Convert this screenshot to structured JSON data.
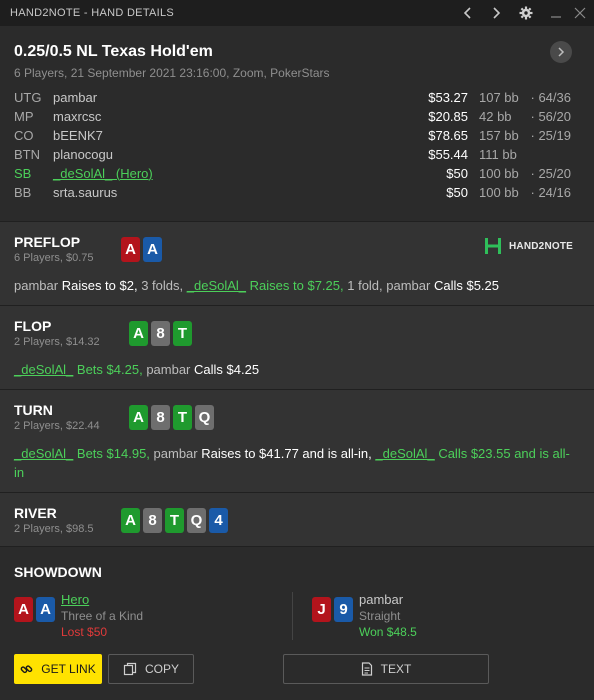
{
  "window": {
    "title": "HAND2NOTE - HAND DETAILS",
    "icons": [
      "chevron-left-icon",
      "chevron-right-icon",
      "gear-icon",
      "minimize-icon",
      "close-icon"
    ]
  },
  "game": {
    "title": "0.25/0.5 NL Texas Hold'em",
    "subtitle": "6 Players, 21 September 2021 23:16:00, Zoom, PokerStars"
  },
  "players": [
    {
      "pos": "UTG",
      "name": "pambar",
      "stack": "$53.27",
      "bb": "107 bb",
      "stat": "64/36",
      "hero": false
    },
    {
      "pos": "MP",
      "name": "maxrcsc",
      "stack": "$20.85",
      "bb": "42 bb",
      "stat": "56/20",
      "hero": false
    },
    {
      "pos": "CO",
      "name": "bEENK7",
      "stack": "$78.65",
      "bb": "157 bb",
      "stat": "25/19",
      "hero": false
    },
    {
      "pos": "BTN",
      "name": "planocogu",
      "stack": "$55.44",
      "bb": "111 bb",
      "stat": "",
      "hero": false
    },
    {
      "pos": "SB",
      "name": "_deSolAl_ (Hero)",
      "stack": "$50",
      "bb": "100 bb",
      "stat": "25/20",
      "hero": true
    },
    {
      "pos": "BB",
      "name": "srta.saurus",
      "stack": "$50",
      "bb": "100 bb",
      "stat": "24/16",
      "hero": false
    }
  ],
  "stat_separator": "·",
  "logo": {
    "text": "HAND2NOTE"
  },
  "streets": {
    "preflop": {
      "name": "PREFLOP",
      "sub": "6 Players, $0.75",
      "cards": [
        {
          "rank": "A",
          "color": "red"
        },
        {
          "rank": "A",
          "color": "blue"
        }
      ],
      "action": {
        "p1": "pambar",
        "a1": "Raises to $2,",
        "p2": "3 folds,",
        "hero": "_deSolAl_",
        "heroact": "Raises to $7.25,",
        "p3": "1 fold, pambar",
        "a3": "Calls $5.25"
      }
    },
    "flop": {
      "name": "FLOP",
      "sub": "2 Players, $14.32",
      "cards": [
        {
          "rank": "A",
          "color": "green"
        },
        {
          "rank": "8",
          "color": "grey"
        },
        {
          "rank": "T",
          "color": "green"
        }
      ],
      "action": {
        "hero": "_deSolAl_",
        "heroact": "Bets $4.25,",
        "p2": "pambar",
        "a2": "Calls $4.25"
      }
    },
    "turn": {
      "name": "TURN",
      "sub": "2 Players, $22.44",
      "cards": [
        {
          "rank": "A",
          "color": "green"
        },
        {
          "rank": "8",
          "color": "grey"
        },
        {
          "rank": "T",
          "color": "green"
        },
        {
          "rank": "Q",
          "color": "grey"
        }
      ],
      "action": {
        "hero": "_deSolAl_",
        "heroact": "Bets $14.95,",
        "p2": "pambar",
        "a2": "Raises to $41.77 and is all-in,",
        "hero2": "_deSolAl_",
        "heroact2": "Calls $23.55 and is all-in"
      }
    },
    "river": {
      "name": "RIVER",
      "sub": "2 Players, $98.5",
      "cards": [
        {
          "rank": "A",
          "color": "green"
        },
        {
          "rank": "8",
          "color": "grey"
        },
        {
          "rank": "T",
          "color": "green"
        },
        {
          "rank": "Q",
          "color": "grey"
        },
        {
          "rank": "4",
          "color": "blue"
        }
      ]
    }
  },
  "showdown": {
    "title": "SHOWDOWN",
    "players": [
      {
        "name": "Hero",
        "hand": "Three of a Kind",
        "result": "Lost $50",
        "result_color": "#e03a3a",
        "cards": [
          {
            "rank": "A",
            "color": "red"
          },
          {
            "rank": "A",
            "color": "blue"
          }
        ]
      },
      {
        "name": "pambar",
        "hand": "Straight",
        "result": "Won $48.5",
        "result_color": "#4cd05a",
        "cards": [
          {
            "rank": "J",
            "color": "red"
          },
          {
            "rank": "9",
            "color": "blue"
          }
        ]
      }
    ]
  },
  "buttons": {
    "get_link": "GET LINK",
    "copy": "COPY",
    "text": "TEXT"
  },
  "colors": {
    "accent_green": "#4cd05a",
    "button_yellow": "#ffe200",
    "card_red": "#b3141c",
    "card_blue": "#1a5aa8",
    "card_green": "#1f9a2e",
    "card_grey": "#6e6e6e"
  }
}
